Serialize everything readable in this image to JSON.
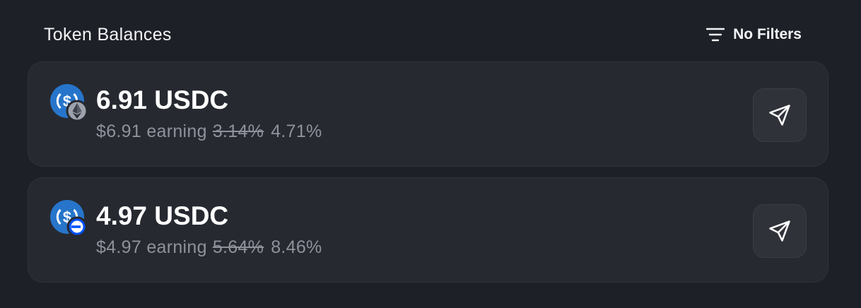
{
  "header": {
    "title": "Token Balances",
    "filter_label": "No Filters",
    "filter_icon": "filter-lines-icon"
  },
  "tokens": [
    {
      "amount": "6.91 USDC",
      "usd_value": "$6.91",
      "earning_label": "earning",
      "old_rate": "3.14%",
      "new_rate": "4.71%",
      "icon": "usdc-icon",
      "network_icon": "ethereum-badge-icon",
      "action_icon": "send-icon"
    },
    {
      "amount": "4.97 USDC",
      "usd_value": "$4.97",
      "earning_label": "earning",
      "old_rate": "5.64%",
      "new_rate": "8.46%",
      "icon": "usdc-icon",
      "network_icon": "base-badge-icon",
      "action_icon": "send-icon"
    }
  ],
  "colors": {
    "background": "#1e2027",
    "card": "#262930",
    "usdc_blue": "#2775ca",
    "muted_text": "#8e929b"
  }
}
